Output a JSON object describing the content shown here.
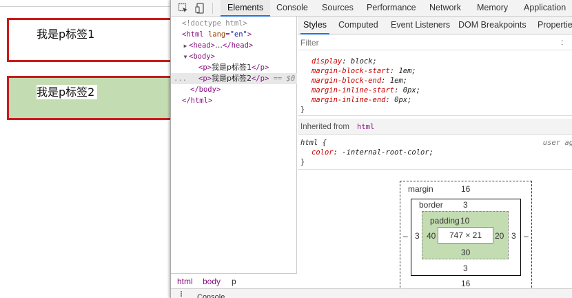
{
  "page": {
    "paragraphs": [
      "我是p标签1",
      "我是p标签2"
    ],
    "colors": {
      "border": "#c81c1c",
      "highlight": "#c3dcb2"
    }
  },
  "devtools": {
    "tabs": [
      "Elements",
      "Console",
      "Sources",
      "Performance",
      "Network",
      "Memory",
      "Application"
    ],
    "active_tab": "Elements",
    "dom": {
      "doctype": "<!doctype html>",
      "html_open_tag": "html",
      "html_attr_name": "lang",
      "html_attr_value": "\"en\"",
      "head_tag": "head",
      "head_ellipsis": "…",
      "body_tag": "body",
      "p_tag": "p",
      "p1_text": "我是p标签1",
      "p2_text": "我是p标签2",
      "selected_marker": "== $0",
      "row_dots": "..."
    },
    "breadcrumb": [
      "html",
      "body",
      "p"
    ],
    "styles": {
      "subtabs": [
        "Styles",
        "Computed",
        "Event Listeners",
        "DOM Breakpoints",
        "Properties"
      ],
      "filter_placeholder": "Filter",
      "filter_colon": ":",
      "p_rule": [
        {
          "prop": "display",
          "value": "block;"
        },
        {
          "prop": "margin-block-start",
          "value": "1em;"
        },
        {
          "prop": "margin-block-end",
          "value": "1em;"
        },
        {
          "prop": "margin-inline-start",
          "value": "0px;"
        },
        {
          "prop": "margin-inline-end",
          "value": "0px;"
        }
      ],
      "close_brace": "}",
      "inherited_label": "Inherited from",
      "inherited_from": "html",
      "html_selector": "html {",
      "html_source": "user agent",
      "html_rule": [
        {
          "prop": "color",
          "value": "-internal-root-color;"
        }
      ]
    },
    "box_model": {
      "margin_label": "margin",
      "margin_top": "16",
      "margin_bottom": "16",
      "margin_left": "–",
      "margin_right": "–",
      "border_label": "border",
      "border_top": "3",
      "border_bottom": "3",
      "border_left": "3",
      "border_right": "3",
      "padding_label": "padding",
      "padding_top": "10",
      "padding_bottom": "30",
      "padding_left": "40",
      "padding_right": "20",
      "content": "747 × 21"
    },
    "drawer_label": "Console"
  }
}
